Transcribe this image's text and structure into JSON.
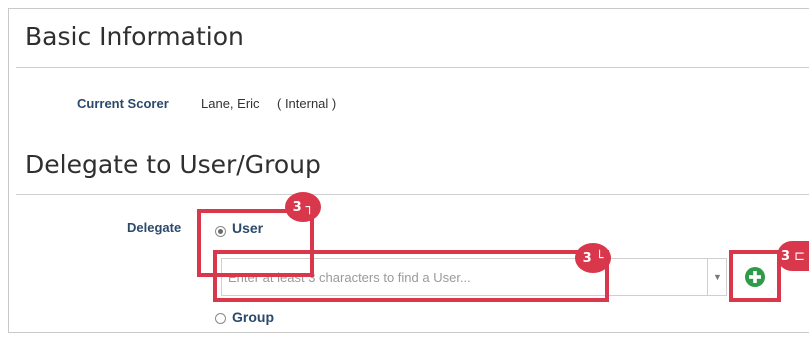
{
  "basic_info": {
    "title": "Basic Information",
    "current_scorer_label": "Current Scorer",
    "current_scorer_value": "Lane, Eric",
    "current_scorer_type": "( Internal )"
  },
  "delegate": {
    "title": "Delegate to User/Group",
    "field_label": "Delegate",
    "user_option_label": "User",
    "group_option_label": "Group",
    "selected_option": "User",
    "search_value": "",
    "search_placeholder": "Enter at least 3 characters to find a User..."
  },
  "annotations": {
    "step_user": "3",
    "step_search": "3",
    "step_add": "3",
    "icon_user": "⌐-corner-icon",
    "icon_search": "⌙-corner-icon",
    "icon_add": "⊏-bracket-icon"
  },
  "colors": {
    "highlight": "#d9374b",
    "label_blue": "#2b4a6b",
    "add_green": "#2e9a4a"
  }
}
